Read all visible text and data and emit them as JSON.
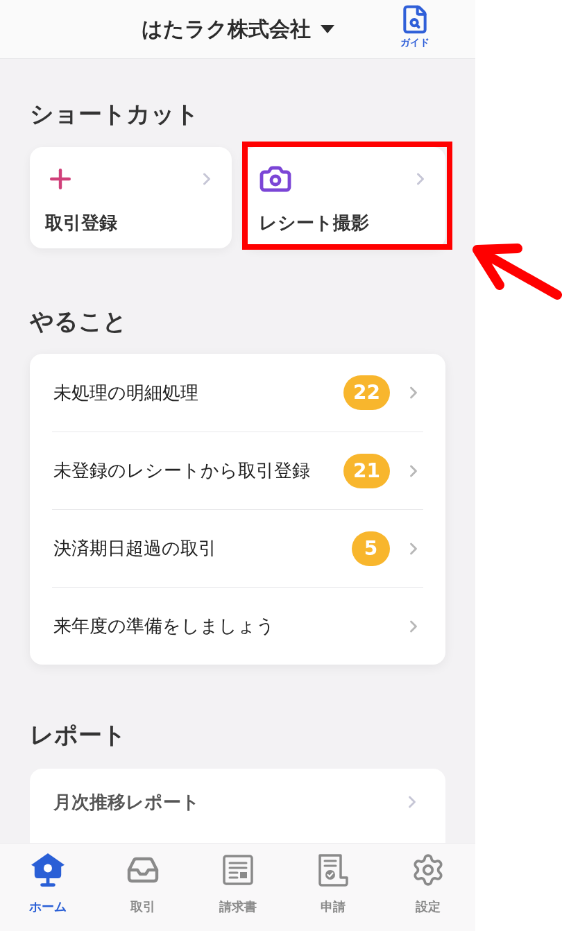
{
  "header": {
    "title": "はたラク株式会社",
    "guide_label": "ガイド"
  },
  "shortcuts": {
    "heading": "ショートカット",
    "items": [
      {
        "kind": "add",
        "label": "取引登録",
        "highlighted": false
      },
      {
        "kind": "camera",
        "label": "レシート撮影",
        "highlighted": true
      }
    ]
  },
  "todo": {
    "heading": "やること",
    "items": [
      {
        "label": "未処理の明細処理",
        "count": "22"
      },
      {
        "label": "未登録のレシートから取引登録",
        "count": "21"
      },
      {
        "label": "決済期日超過の取引",
        "count": "5"
      },
      {
        "label": "来年度の準備をしましょう"
      }
    ]
  },
  "reports": {
    "heading": "レポート",
    "items": [
      {
        "label": "月次推移レポート"
      }
    ]
  },
  "tab_bar": {
    "tabs": [
      {
        "kind": "home",
        "label": "ホーム",
        "selected": true
      },
      {
        "kind": "transactions",
        "label": "取引",
        "selected": false
      },
      {
        "kind": "invoices",
        "label": "請求書",
        "selected": false
      },
      {
        "kind": "applications",
        "label": "申請",
        "selected": false
      },
      {
        "kind": "settings",
        "label": "設定",
        "selected": false
      }
    ]
  }
}
